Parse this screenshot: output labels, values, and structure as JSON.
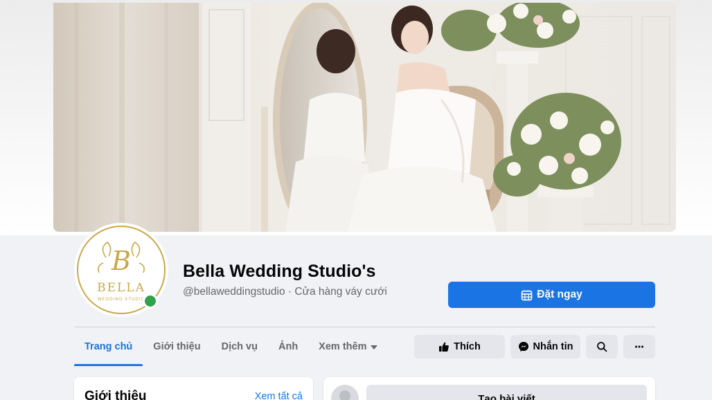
{
  "page": {
    "name": "Bella Wedding Studio's",
    "handle": "@bellaweddingstudio",
    "separator": " · ",
    "category": "Cửa hàng váy cưới"
  },
  "logo": {
    "monogram": "B",
    "brand": "BELLA",
    "tagline": "WEDDING STUDIO"
  },
  "cta": {
    "label": "Đặt ngay",
    "icon": "calendar-icon"
  },
  "tabs": [
    {
      "label": "Trang chủ",
      "active": true
    },
    {
      "label": "Giới thiệu"
    },
    {
      "label": "Dịch vụ"
    },
    {
      "label": "Ảnh"
    },
    {
      "label": "Xem thêm"
    }
  ],
  "actions": {
    "like": "Thích",
    "message": "Nhắn tin",
    "search_icon": "search-icon",
    "more_icon": "more-icon"
  },
  "intro": {
    "title": "Giới thiệu",
    "see_all": "Xem tất cả"
  },
  "composer": {
    "label": "Tạo bài viết"
  },
  "colors": {
    "accent": "#1b74e4",
    "online": "#31a24c",
    "gold": "#c9a847",
    "button_bg": "#e4e6eb"
  }
}
